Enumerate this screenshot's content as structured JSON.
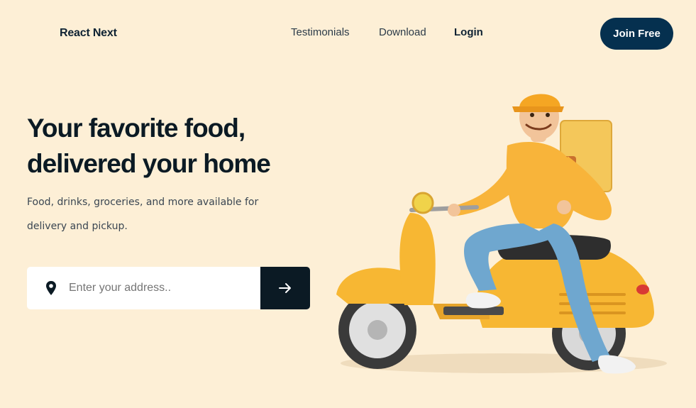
{
  "nav": {
    "brand": "React Next",
    "links": [
      "Testimonials",
      "Download",
      "Login"
    ],
    "cta": "Join Free"
  },
  "hero": {
    "title_line1": "Your favorite food,",
    "title_line2": "delivered your home",
    "subtitle": "Food, drinks, groceries, and more available for delivery and pickup."
  },
  "search": {
    "placeholder": "Enter your address..",
    "value": "",
    "icon": "map-pin-icon",
    "submit_icon": "arrow-right-icon"
  },
  "colors": {
    "background": "#FDEFD6",
    "primary": "#05304F",
    "dark": "#0B1A24",
    "scooter": "#F7B733",
    "jeans": "#6FA7CF"
  }
}
